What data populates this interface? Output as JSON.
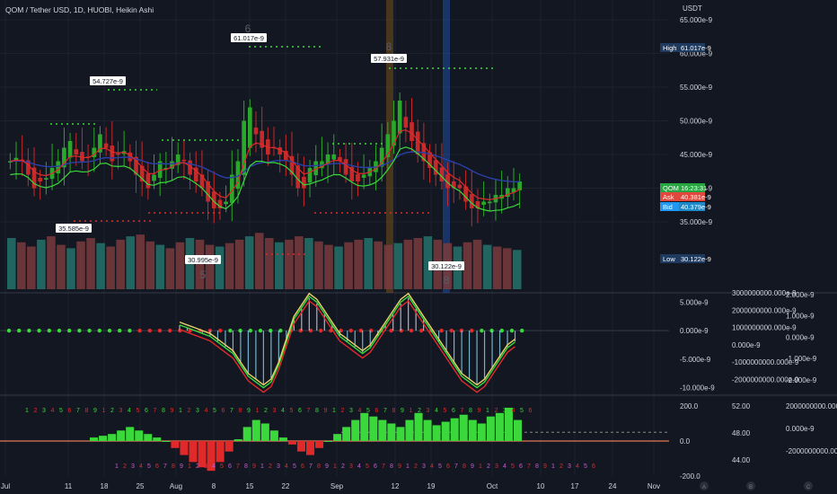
{
  "header": {
    "title": "QOM / Tether USD, 1D, HUOBI, Heikin Ashi"
  },
  "chart_data": {
    "type": "candlestick",
    "title": "QOM / Tether USD, 1D, HUOBI, Heikin Ashi",
    "currency": "USDT",
    "price_axis": {
      "ticks": [
        "65.000e-9",
        "60.000e-9",
        "55.000e-9",
        "50.000e-9",
        "45.000e-9",
        "40.000e-9",
        "35.000e-9"
      ],
      "ylim": [
        30,
        65
      ]
    },
    "x_ticks": [
      "Jul",
      "11",
      "18",
      "25",
      "Aug",
      "8",
      "15",
      "22",
      "Sep",
      "12",
      "19",
      "Oct",
      "10",
      "17",
      "24",
      "Nov"
    ],
    "ha_close": [
      44,
      44.5,
      44,
      42,
      40,
      41,
      41.5,
      43,
      44,
      46,
      47,
      45,
      44,
      44.5,
      46,
      48,
      46,
      44,
      45,
      45.5,
      44,
      42,
      41,
      40,
      42,
      44,
      43,
      44,
      45,
      44,
      42,
      41,
      40,
      38,
      37,
      37,
      38,
      42,
      44,
      50,
      52,
      48,
      46,
      45,
      46,
      45,
      44,
      42,
      40,
      40,
      43,
      44,
      44,
      45,
      45,
      44,
      42,
      41,
      41,
      42,
      43,
      44,
      46,
      48,
      50,
      53,
      49,
      47,
      45,
      44,
      43,
      42,
      41,
      40,
      40,
      40,
      38,
      37,
      37,
      38,
      38,
      39,
      39,
      40,
      40,
      41
    ],
    "candle_colors": [
      "#26a69a",
      "#ef5350"
    ],
    "markers": {
      "high_label": "61.017e-9",
      "low_label": "30.122e-9",
      "local_highs": [
        "54.727e-9",
        "61.017e-9",
        "57.931e-9"
      ],
      "local_lows": [
        "35.585e-9",
        "30.995e-9",
        "30.122e-9"
      ],
      "count_marks": [
        "6",
        "8",
        "5",
        "8"
      ]
    },
    "price_tags": [
      {
        "label": "High",
        "value": "61.017e-9",
        "color": "#1e3a5f"
      },
      {
        "label": "QOMUSDT",
        "value": "16:23:31",
        "color": "#26a641"
      },
      {
        "label": "Ask",
        "value": "40.381e-9",
        "color": "#e0483e"
      },
      {
        "label": "Bid",
        "value": "40.379e-9",
        "color": "#2196f3"
      },
      {
        "label": "Low",
        "value": "30.122e-9",
        "color": "#1e3a5f"
      }
    ],
    "macd_axis": {
      "ticks": [
        "5.000e-9",
        "0.000e-9",
        "-5.000e-9",
        "-10.000e-9"
      ]
    },
    "macd_axis_2": {
      "ticks": [
        "3000000000.000e-9",
        "2000000000.000e-9",
        "1000000000.000e-9",
        "0.000e-9",
        "-1000000000.000e-9",
        "-2000000000.000e-9"
      ]
    },
    "macd_axis_3": {
      "ticks": [
        "2.000e-9",
        "1.000e-9",
        "0.000e-9",
        "-1.000e-9",
        "-2.000e-9"
      ]
    },
    "osc_axis": {
      "ticks": [
        "200.0",
        "0.0",
        "-200.0"
      ]
    },
    "osc_axis_2": {
      "ticks": [
        "52.00",
        "48.00",
        "44.00"
      ]
    },
    "osc_axis_3": {
      "ticks": [
        "2000000000.000e-9",
        "0.000e-9",
        "-2000000000.000e-9"
      ]
    },
    "macd_line": [
      1,
      0.5,
      0,
      -0.5,
      -1,
      -2,
      -3,
      -4,
      -6,
      -8,
      -9,
      -10,
      -9,
      -6,
      -2,
      2,
      4,
      6,
      5,
      3,
      1,
      -1,
      -2,
      -3,
      -4,
      -3,
      -1,
      1,
      3,
      5,
      6,
      4,
      2,
      0,
      -2,
      -4,
      -6,
      -8,
      -9,
      -10,
      -9,
      -7,
      -5,
      -3,
      -2
    ],
    "osc_values": [
      20,
      30,
      40,
      60,
      80,
      60,
      40,
      20,
      0,
      -40,
      -80,
      -120,
      -150,
      -170,
      -120,
      -60,
      10,
      80,
      120,
      100,
      60,
      20,
      -20,
      -60,
      -80,
      -40,
      0,
      40,
      80,
      120,
      160,
      140,
      120,
      100,
      80,
      120,
      160,
      120,
      90,
      110,
      130,
      150,
      120,
      100,
      140,
      160,
      190,
      120
    ],
    "volume": [
      60,
      55,
      50,
      58,
      62,
      52,
      48,
      56,
      60,
      54,
      50,
      58,
      62,
      64,
      56,
      52,
      48,
      55,
      60,
      58,
      52,
      50,
      54,
      58,
      62,
      66,
      60,
      55,
      58,
      62,
      60,
      56,
      52,
      50,
      55,
      58,
      60,
      56,
      52,
      54,
      58,
      60,
      62,
      58,
      54,
      50,
      55,
      58,
      52,
      50,
      48,
      46
    ]
  }
}
